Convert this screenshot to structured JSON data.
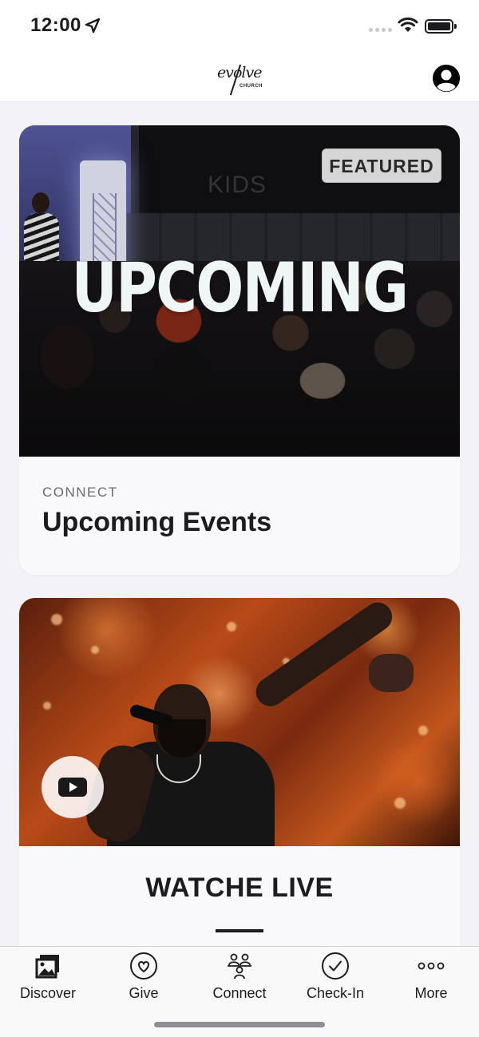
{
  "status_bar": {
    "time": "12:00",
    "icons": [
      "location-arrow-icon",
      "signal-dots-icon",
      "wifi-icon",
      "battery-icon"
    ]
  },
  "nav": {
    "logo_script": "evolve",
    "logo_sub": "CHURCH",
    "profile_icon": "person-circle-icon"
  },
  "cards": [
    {
      "badge": "FEATURED",
      "image_overlay_text": "UPCOMING",
      "image_sign_text": "KIDS",
      "eyebrow": "CONNECT",
      "title": "Upcoming Events"
    },
    {
      "play_icon": "youtube-play-icon",
      "title": "WATCHE LIVE"
    }
  ],
  "tab_bar": {
    "tabs": [
      {
        "label": "Discover",
        "icon": "photos-icon"
      },
      {
        "label": "Give",
        "icon": "heart-circle-icon"
      },
      {
        "label": "Connect",
        "icon": "people-group-icon"
      },
      {
        "label": "Check-In",
        "icon": "checkmark-circle-icon"
      },
      {
        "label": "More",
        "icon": "ellipsis-icon"
      }
    ]
  },
  "colors": {
    "background": "#f2f2f7",
    "card": "#f9f9fb",
    "text_primary": "#1c1c1e",
    "text_secondary": "#6b6b70",
    "badge_bg": "#d6d6d6"
  }
}
